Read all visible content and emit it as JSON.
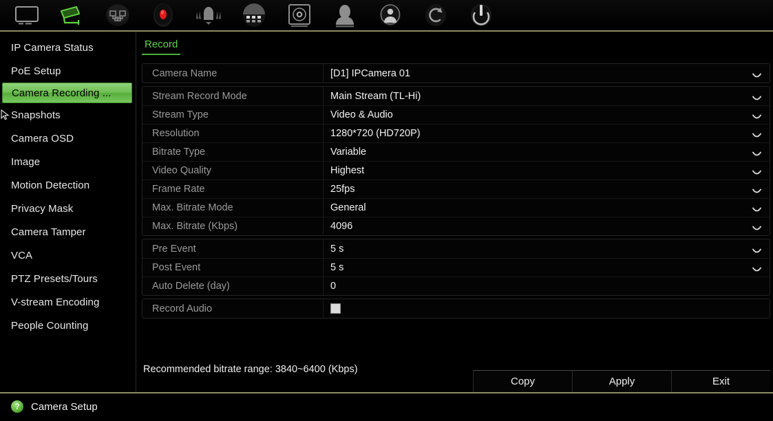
{
  "toolbar": {
    "items": [
      {
        "name": "monitor-icon",
        "label": "Live View",
        "active": false
      },
      {
        "name": "camera-icon",
        "label": "Camera Setup",
        "active": true
      },
      {
        "name": "network-icon",
        "label": "Network Setup",
        "active": false
      },
      {
        "name": "record-icon",
        "label": "Record Setup",
        "active": false
      },
      {
        "name": "alarm-icon",
        "label": "Alarm Setup",
        "active": false
      },
      {
        "name": "calendar-icon",
        "label": "Schedule Setup",
        "active": false
      },
      {
        "name": "hard-disk-icon",
        "label": "Disk Setup",
        "active": false
      },
      {
        "name": "user-icon",
        "label": "User Setup",
        "active": false
      },
      {
        "name": "system-info-icon",
        "label": "System Setup",
        "active": false
      },
      {
        "name": "maintenance-icon",
        "label": "Maintenance",
        "active": false
      },
      {
        "name": "shutdown-icon",
        "label": "Shutdown",
        "active": false
      }
    ]
  },
  "sidebar": {
    "items": [
      {
        "label": "IP Camera Status",
        "selected": false
      },
      {
        "label": "PoE Setup",
        "selected": false
      },
      {
        "label": "Camera Recording ...",
        "selected": true
      },
      {
        "label": "Snapshots",
        "selected": false,
        "cursor": true
      },
      {
        "label": "Camera OSD",
        "selected": false
      },
      {
        "label": "Image",
        "selected": false
      },
      {
        "label": "Motion Detection",
        "selected": false
      },
      {
        "label": "Privacy Mask",
        "selected": false
      },
      {
        "label": "Camera Tamper",
        "selected": false
      },
      {
        "label": "VCA",
        "selected": false
      },
      {
        "label": "PTZ Presets/Tours",
        "selected": false
      },
      {
        "label": "V-stream Encoding",
        "selected": false
      },
      {
        "label": "People Counting",
        "selected": false
      }
    ]
  },
  "main": {
    "tabs": [
      {
        "label": "Record",
        "active": true
      }
    ],
    "groups": [
      {
        "rows": [
          {
            "label": "Camera Name",
            "value": "[D1] IPCamera 01",
            "control": "dropdown"
          }
        ]
      },
      {
        "rows": [
          {
            "label": "Stream Record Mode",
            "value": "Main Stream (TL-Hi)",
            "control": "dropdown"
          },
          {
            "label": "Stream Type",
            "value": "Video & Audio",
            "control": "dropdown"
          },
          {
            "label": "Resolution",
            "value": "1280*720 (HD720P)",
            "control": "dropdown"
          },
          {
            "label": "Bitrate Type",
            "value": "Variable",
            "control": "dropdown"
          },
          {
            "label": "Video Quality",
            "value": "Highest",
            "control": "dropdown"
          },
          {
            "label": "Frame Rate",
            "value": "25fps",
            "control": "dropdown"
          },
          {
            "label": "Max. Bitrate Mode",
            "value": "General",
            "control": "dropdown"
          },
          {
            "label": "Max. Bitrate (Kbps)",
            "value": "4096",
            "control": "dropdown"
          }
        ]
      },
      {
        "rows": [
          {
            "label": "Pre Event",
            "value": "5 s",
            "control": "dropdown"
          },
          {
            "label": "Post Event",
            "value": "5 s",
            "control": "dropdown"
          },
          {
            "label": "Auto Delete (day)",
            "value": "0",
            "control": "text"
          }
        ]
      },
      {
        "rows": [
          {
            "label": "Record Audio",
            "value": "",
            "control": "checkbox",
            "checked": false
          }
        ]
      }
    ],
    "hint": "Recommended bitrate range: 3840~6400 (Kbps)",
    "buttons": [
      {
        "label": "Copy"
      },
      {
        "label": "Apply"
      },
      {
        "label": "Exit"
      }
    ]
  },
  "statusbar": {
    "help_icon": "?",
    "label": "Camera Setup"
  },
  "colors": {
    "accent_green": "#5fd148",
    "selected_green": "#6fbf52",
    "divider_olive": "#8c8c64",
    "background": "#000000",
    "text_primary": "#f2f2f2",
    "text_label": "#9a9a9a"
  }
}
